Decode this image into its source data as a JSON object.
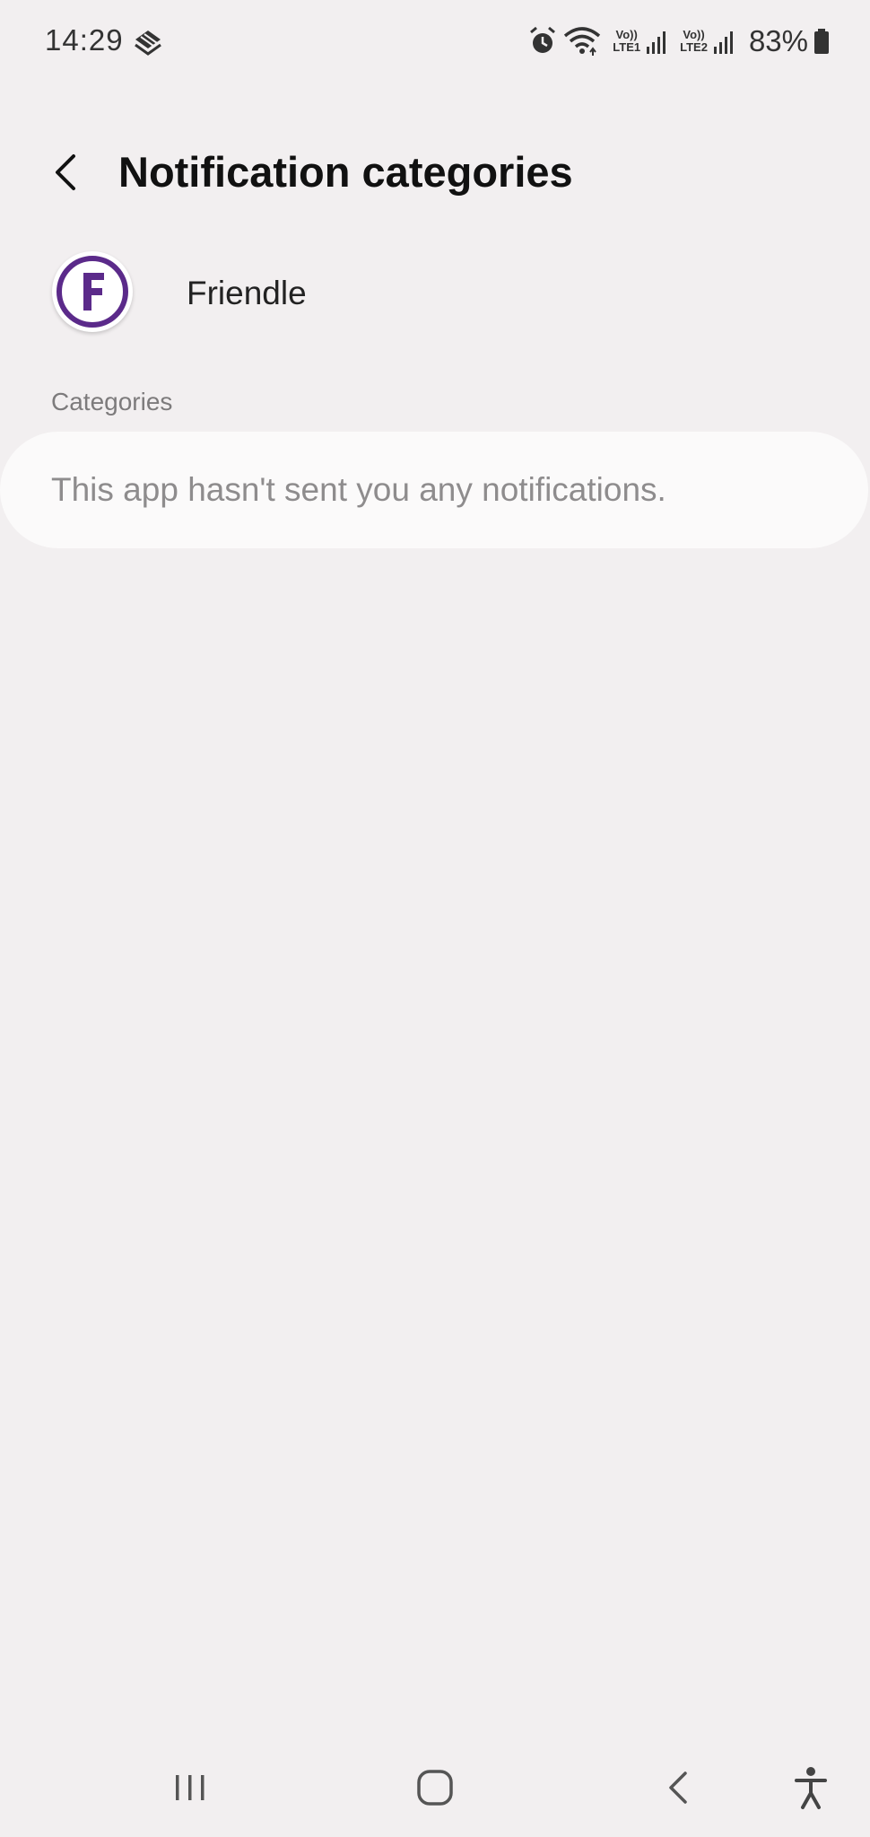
{
  "status_bar": {
    "time": "14:29",
    "sim1_label_top": "Vo))",
    "sim1_label_bottom": "LTE1",
    "sim2_label_top": "Vo))",
    "sim2_label_bottom": "LTE2",
    "battery_percent": "83%",
    "icons": [
      "app-notification-icon",
      "alarm-icon",
      "wifi-icon",
      "signal-icon",
      "signal-icon",
      "battery-icon"
    ]
  },
  "header": {
    "title": "Notification categories",
    "back_icon": "chevron-left-icon"
  },
  "app": {
    "name": "Friendle",
    "icon_letter": "F",
    "icon_color": "#5b2a8a"
  },
  "categories": {
    "section_label": "Categories",
    "empty_message": "This app hasn't sent you any notifications."
  },
  "navigation_bar": {
    "buttons": [
      "recent-apps-icon",
      "home-icon",
      "back-icon",
      "accessibility-icon"
    ]
  }
}
